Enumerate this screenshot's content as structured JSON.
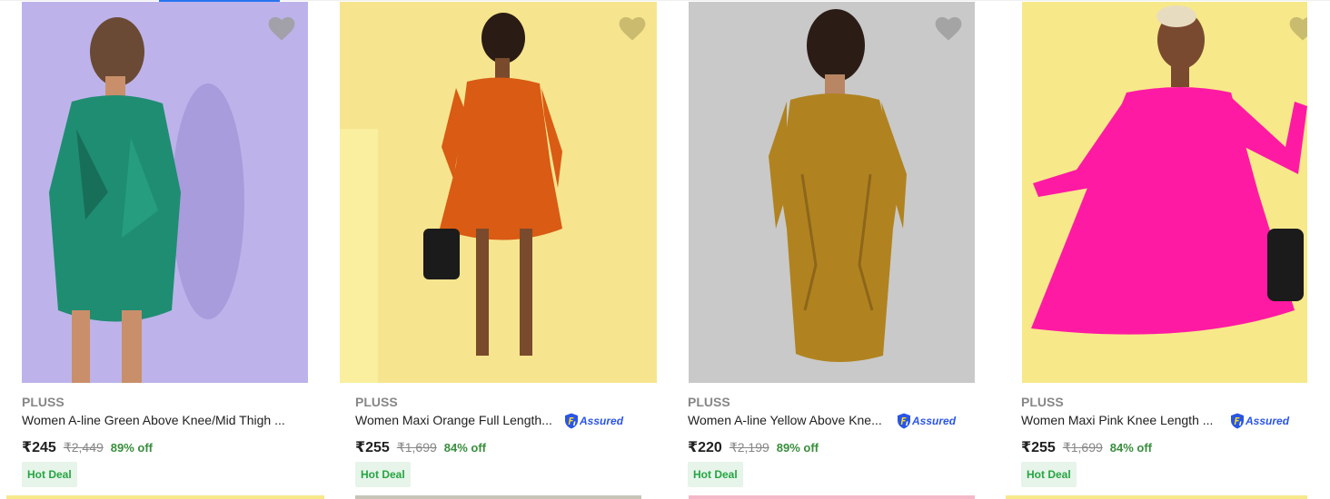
{
  "colors": {
    "accent": "#2874f0",
    "discount": "#388e3c",
    "deal_bg": "#e6f4ea",
    "deal_fg": "#26a541",
    "assured": "#2a55e5"
  },
  "products": [
    {
      "brand": "PLUSS",
      "title": "Women A-line Green Above Knee/Mid Thigh ...",
      "price": "₹245",
      "mrp": "₹2,449",
      "discount": "89% off",
      "badge": "Hot Deal",
      "assured": false,
      "image_bg": "#bdb3ea",
      "dress_color": "#1f8d72",
      "wishlist_icon": "heart-icon"
    },
    {
      "brand": "PLUSS",
      "title": "Women Maxi Orange Full Length...",
      "price": "₹255",
      "mrp": "₹1,699",
      "discount": "84% off",
      "badge": "Hot Deal",
      "assured": true,
      "assured_label": "Assured",
      "image_bg": "#f6e58e",
      "dress_color": "#d95b14",
      "wishlist_icon": "heart-icon"
    },
    {
      "brand": "PLUSS",
      "title": "Women A-line Yellow Above Kne...",
      "price": "₹220",
      "mrp": "₹2,199",
      "discount": "89% off",
      "badge": "Hot Deal",
      "assured": true,
      "assured_label": "Assured",
      "image_bg": "#c9c9c9",
      "dress_color": "#b08320",
      "wishlist_icon": "heart-icon"
    },
    {
      "brand": "PLUSS",
      "title": "Women Maxi Pink Knee Length ...",
      "price": "₹255",
      "mrp": "₹1,699",
      "discount": "84% off",
      "badge": "Hot Deal",
      "assured": true,
      "assured_label": "Assured",
      "image_bg": "#f7e88a",
      "dress_color": "#ff1aa3",
      "wishlist_icon": "heart-icon"
    }
  ]
}
